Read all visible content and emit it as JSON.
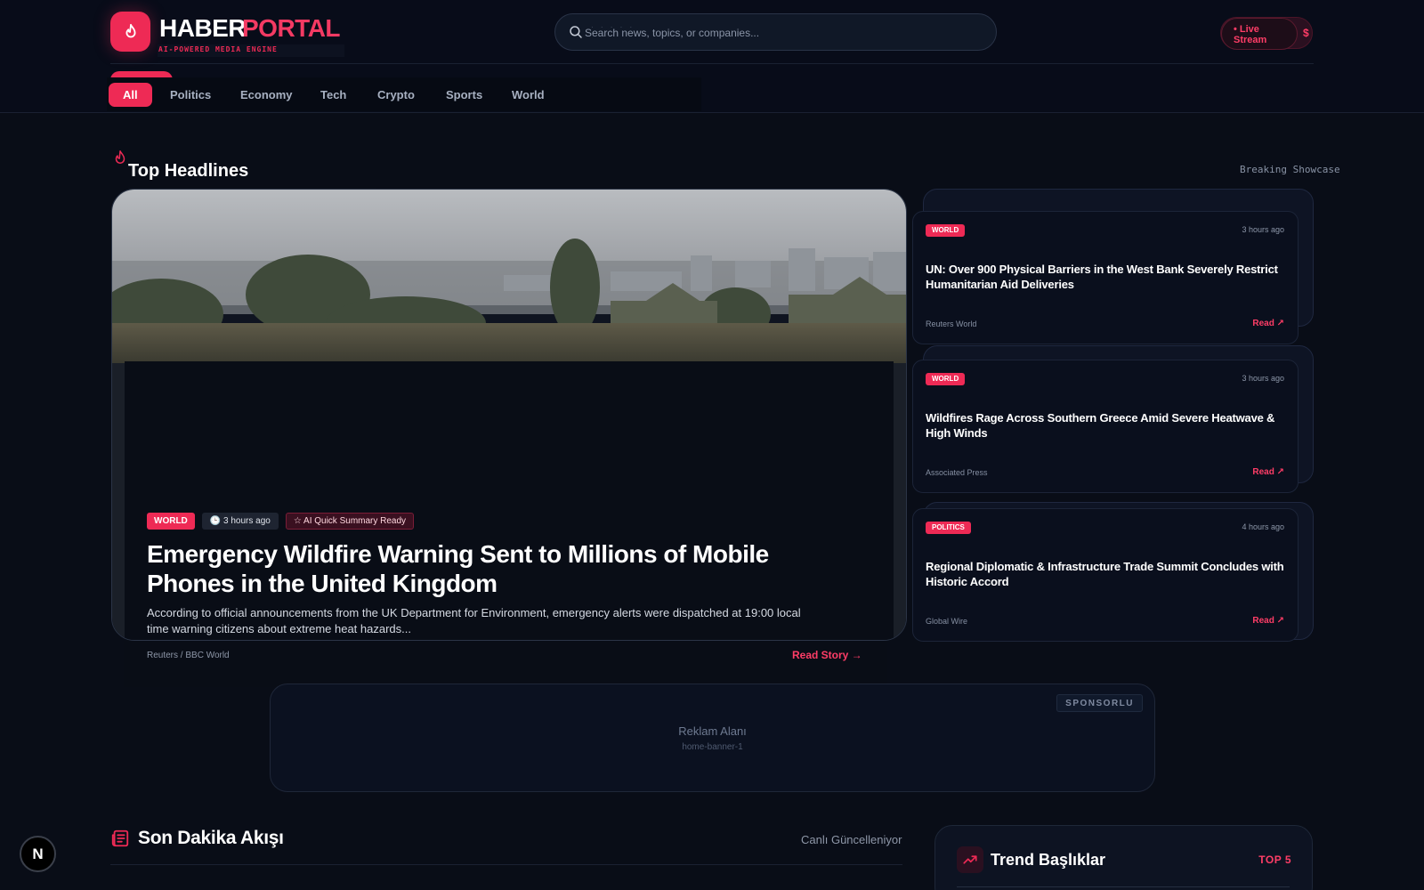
{
  "brand": {
    "name_primary": "HABER",
    "name_accent": "PORTAL",
    "tagline": "AI-POWERED MEDIA ENGINE",
    "accent_color": "#ee2a55",
    "logo_icon": "flame-icon"
  },
  "search": {
    "placeholder": "Search news, topics, or companies...",
    "icon": "search-icon"
  },
  "header_actions": {
    "live_label": "• Live\nStream",
    "extra_label": "$"
  },
  "categories": [
    {
      "label": "All",
      "active": true
    },
    {
      "label": "Politics"
    },
    {
      "label": "Economy"
    },
    {
      "label": "Tech"
    },
    {
      "label": "Crypto"
    },
    {
      "label": "Sports"
    },
    {
      "label": "World"
    }
  ],
  "headlines": {
    "title": "Top Headlines",
    "showcase_label": "Breaking Showcase"
  },
  "hero": {
    "category": "WORLD",
    "time": "🕒 3 hours ago",
    "ai_badge": "☆ AI Quick Summary Ready",
    "title": "Emergency Wildfire Warning Sent to Millions of Mobile Phones in the United Kingdom",
    "summary": "According to official announcements from the UK Department for Environment, emergency alerts were dispatched at 19:00 local time warning citizens about extreme heat hazards...",
    "source": "Reuters / BBC World",
    "read_label": "Read Story →"
  },
  "side_stories": [
    {
      "category": "WORLD",
      "time": "3 hours ago",
      "title": "UN: Over 900 Physical Barriers in the West Bank Severely Restrict Humanitarian Aid Deliveries",
      "source": "Reuters World",
      "read_label": "Read ↗"
    },
    {
      "category": "WORLD",
      "time": "3 hours ago",
      "title": "Wildfires Rage Across Southern Greece Amid Severe Heatwave & High Winds",
      "source": "Associated Press",
      "read_label": "Read ↗"
    },
    {
      "category": "POLITICS",
      "time": "4 hours ago",
      "title": "Regional Diplomatic & Infrastructure Trade Summit Concludes with Historic Accord",
      "source": "Global Wire",
      "read_label": "Read ↗"
    }
  ],
  "ad": {
    "badge": "SPONSORLU",
    "title": "Reklam Alanı",
    "slot": "home-banner-1"
  },
  "feed": {
    "title": "Son Dakika Akışı",
    "status": "Canlı Güncelleniyor"
  },
  "trending": {
    "title": "Trend Başlıklar",
    "badge": "TOP 5"
  },
  "dev_badge": "N"
}
